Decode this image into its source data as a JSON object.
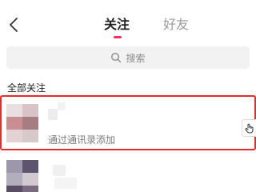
{
  "nav": {
    "tabs": [
      {
        "label": "关注",
        "active": true
      },
      {
        "label": "好友",
        "active": false
      }
    ]
  },
  "search": {
    "placeholder": "搜索"
  },
  "section": {
    "title": "全部关注"
  },
  "follow_list": [
    {
      "subtitle": "通过通讯录添加",
      "highlighted": true
    },
    {
      "subtitle": "",
      "highlighted": false
    }
  ],
  "icons": [
    "back-chevron",
    "search",
    "hand-pointer"
  ],
  "colors": {
    "accent": "#fe2c55",
    "highlight_border": "#e02d2d",
    "search_bg": "#f2f2f2",
    "inactive_tab": "#9a9a9a"
  }
}
